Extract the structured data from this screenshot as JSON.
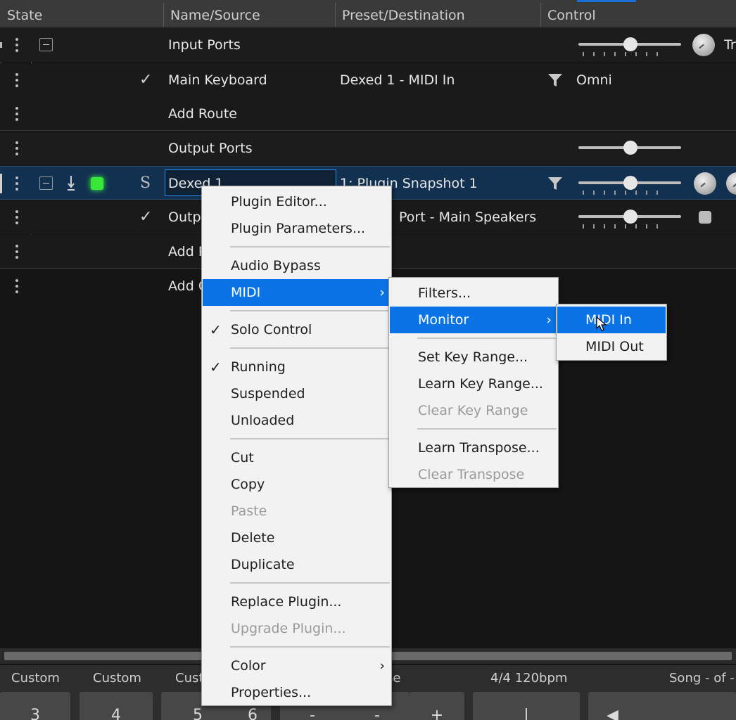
{
  "header": {
    "columns": [
      "State",
      "Name/Source",
      "Preset/Destination",
      "Control"
    ]
  },
  "rows": {
    "input_ports": {
      "name": "Input Ports",
      "control_label": "Tr"
    },
    "main_keyboard": {
      "name": "Main Keyboard",
      "destination": "Dexed 1 - MIDI In",
      "control": "Omni"
    },
    "add_route": {
      "name": "Add Route"
    },
    "output_ports": {
      "name": "Output Ports"
    },
    "dexed": {
      "name": "Dexed 1",
      "solo_glyph": "S",
      "preset": "1: Plugin Snapshot 1"
    },
    "output_row": {
      "name": "Outp",
      "destination": "Port - Main Speakers"
    },
    "add_p": {
      "name": "Add P"
    },
    "add_c": {
      "name": "Add C"
    }
  },
  "bottom": {
    "labels": [
      "Custom",
      "Custom",
      "Cust",
      "ose",
      "4/4 120bpm",
      "Song - of -"
    ],
    "buttons": [
      "3",
      "4",
      "5",
      "6",
      "-",
      "-",
      "+",
      "|",
      "◀"
    ]
  },
  "menu": {
    "items": {
      "plugin_editor": "Plugin Editor...",
      "plugin_parameters": "Plugin Parameters...",
      "audio_bypass": "Audio Bypass",
      "midi": "MIDI",
      "solo_control": "Solo Control",
      "running": "Running",
      "suspended": "Suspended",
      "unloaded": "Unloaded",
      "cut": "Cut",
      "copy": "Copy",
      "paste": "Paste",
      "delete": "Delete",
      "duplicate": "Duplicate",
      "replace_plugin": "Replace Plugin...",
      "upgrade_plugin": "Upgrade Plugin...",
      "color": "Color",
      "properties": "Properties..."
    },
    "check_glyph": "✓",
    "arrow_glyph": "›"
  },
  "midi_submenu": {
    "filters": "Filters...",
    "monitor": "Monitor",
    "set_key_range": "Set Key Range...",
    "learn_key_range": "Learn Key Range...",
    "clear_key_range": "Clear Key Range",
    "learn_transpose": "Learn Transpose...",
    "clear_transpose": "Clear Transpose"
  },
  "monitor_submenu": {
    "midi_in": "MIDI In",
    "midi_out": "MIDI Out"
  },
  "colors": {
    "highlight": "#0a73e6",
    "selected_row": "#123150",
    "led_green": "#38e838"
  }
}
